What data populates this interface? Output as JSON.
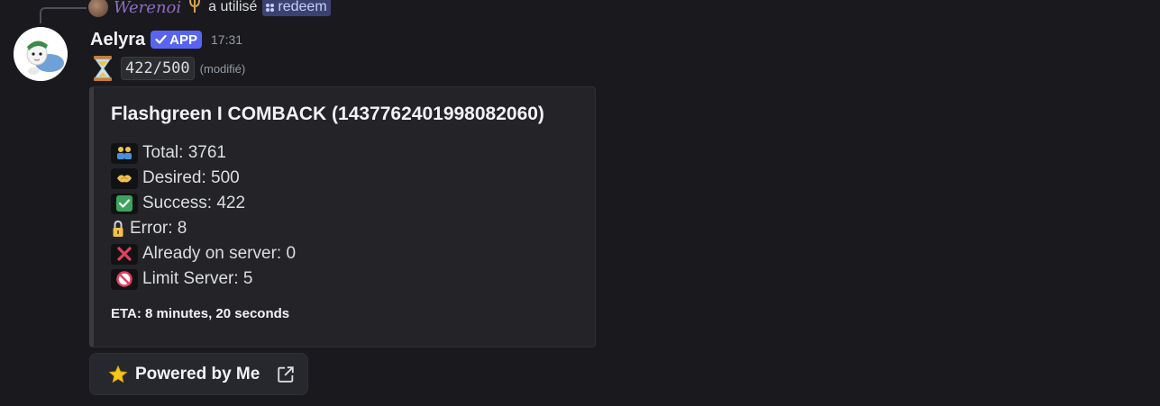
{
  "reply": {
    "user_name": "Werenoi",
    "action_text": "a utilisé",
    "command": "redeem"
  },
  "message": {
    "author": "Aelyra",
    "badge": "APP",
    "timestamp": "17:31",
    "progress_code": "422/500",
    "edited_label": "(modifié)"
  },
  "embed": {
    "title": "Flashgreen I COMBACK (1437762401998082060)",
    "stats": [
      {
        "icon": "people-icon",
        "text": "Total: 3761"
      },
      {
        "icon": "handshake-icon",
        "text": "Desired: 500"
      },
      {
        "icon": "check-icon",
        "text": "Success: 422"
      },
      {
        "icon": "lock-icon",
        "text": "Error: 8"
      },
      {
        "icon": "cross-icon",
        "text": "Already on server: 0"
      },
      {
        "icon": "prohibited-icon",
        "text": "Limit Server: 5"
      }
    ],
    "eta": "ETA: 8 minutes, 20 seconds"
  },
  "button": {
    "label": "Powered by Me",
    "icon": "star-icon",
    "trailing_icon": "external-link-icon"
  },
  "colors": {
    "background": "#1a1a1e",
    "app_badge": "#5865f2",
    "reply_name": "#8e6bc4",
    "command_chip": "#3c4270",
    "check_green": "#3ba55c",
    "cross_red": "#e2405f"
  }
}
